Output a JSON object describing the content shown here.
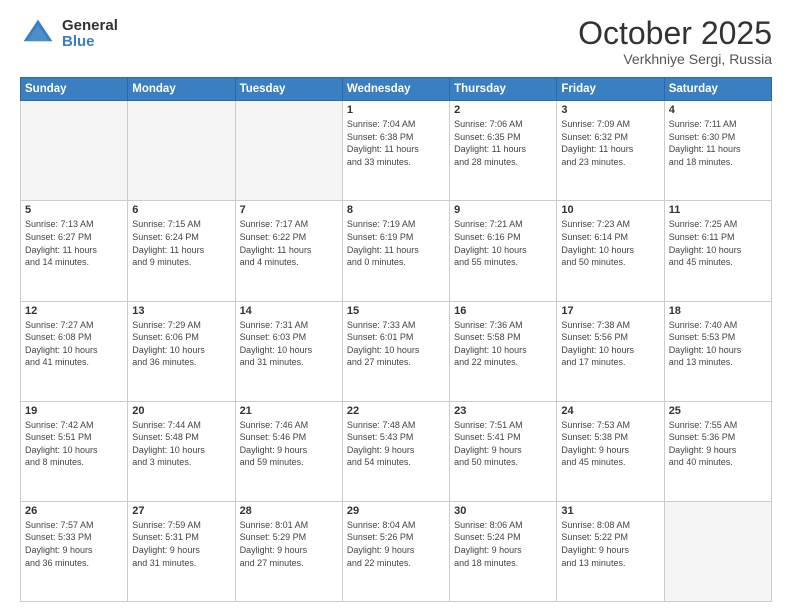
{
  "header": {
    "logo_general": "General",
    "logo_blue": "Blue",
    "month": "October 2025",
    "location": "Verkhniye Sergi, Russia"
  },
  "weekdays": [
    "Sunday",
    "Monday",
    "Tuesday",
    "Wednesday",
    "Thursday",
    "Friday",
    "Saturday"
  ],
  "weeks": [
    [
      {
        "day": "",
        "info": ""
      },
      {
        "day": "",
        "info": ""
      },
      {
        "day": "",
        "info": ""
      },
      {
        "day": "1",
        "info": "Sunrise: 7:04 AM\nSunset: 6:38 PM\nDaylight: 11 hours\nand 33 minutes."
      },
      {
        "day": "2",
        "info": "Sunrise: 7:06 AM\nSunset: 6:35 PM\nDaylight: 11 hours\nand 28 minutes."
      },
      {
        "day": "3",
        "info": "Sunrise: 7:09 AM\nSunset: 6:32 PM\nDaylight: 11 hours\nand 23 minutes."
      },
      {
        "day": "4",
        "info": "Sunrise: 7:11 AM\nSunset: 6:30 PM\nDaylight: 11 hours\nand 18 minutes."
      }
    ],
    [
      {
        "day": "5",
        "info": "Sunrise: 7:13 AM\nSunset: 6:27 PM\nDaylight: 11 hours\nand 14 minutes."
      },
      {
        "day": "6",
        "info": "Sunrise: 7:15 AM\nSunset: 6:24 PM\nDaylight: 11 hours\nand 9 minutes."
      },
      {
        "day": "7",
        "info": "Sunrise: 7:17 AM\nSunset: 6:22 PM\nDaylight: 11 hours\nand 4 minutes."
      },
      {
        "day": "8",
        "info": "Sunrise: 7:19 AM\nSunset: 6:19 PM\nDaylight: 11 hours\nand 0 minutes."
      },
      {
        "day": "9",
        "info": "Sunrise: 7:21 AM\nSunset: 6:16 PM\nDaylight: 10 hours\nand 55 minutes."
      },
      {
        "day": "10",
        "info": "Sunrise: 7:23 AM\nSunset: 6:14 PM\nDaylight: 10 hours\nand 50 minutes."
      },
      {
        "day": "11",
        "info": "Sunrise: 7:25 AM\nSunset: 6:11 PM\nDaylight: 10 hours\nand 45 minutes."
      }
    ],
    [
      {
        "day": "12",
        "info": "Sunrise: 7:27 AM\nSunset: 6:08 PM\nDaylight: 10 hours\nand 41 minutes."
      },
      {
        "day": "13",
        "info": "Sunrise: 7:29 AM\nSunset: 6:06 PM\nDaylight: 10 hours\nand 36 minutes."
      },
      {
        "day": "14",
        "info": "Sunrise: 7:31 AM\nSunset: 6:03 PM\nDaylight: 10 hours\nand 31 minutes."
      },
      {
        "day": "15",
        "info": "Sunrise: 7:33 AM\nSunset: 6:01 PM\nDaylight: 10 hours\nand 27 minutes."
      },
      {
        "day": "16",
        "info": "Sunrise: 7:36 AM\nSunset: 5:58 PM\nDaylight: 10 hours\nand 22 minutes."
      },
      {
        "day": "17",
        "info": "Sunrise: 7:38 AM\nSunset: 5:56 PM\nDaylight: 10 hours\nand 17 minutes."
      },
      {
        "day": "18",
        "info": "Sunrise: 7:40 AM\nSunset: 5:53 PM\nDaylight: 10 hours\nand 13 minutes."
      }
    ],
    [
      {
        "day": "19",
        "info": "Sunrise: 7:42 AM\nSunset: 5:51 PM\nDaylight: 10 hours\nand 8 minutes."
      },
      {
        "day": "20",
        "info": "Sunrise: 7:44 AM\nSunset: 5:48 PM\nDaylight: 10 hours\nand 3 minutes."
      },
      {
        "day": "21",
        "info": "Sunrise: 7:46 AM\nSunset: 5:46 PM\nDaylight: 9 hours\nand 59 minutes."
      },
      {
        "day": "22",
        "info": "Sunrise: 7:48 AM\nSunset: 5:43 PM\nDaylight: 9 hours\nand 54 minutes."
      },
      {
        "day": "23",
        "info": "Sunrise: 7:51 AM\nSunset: 5:41 PM\nDaylight: 9 hours\nand 50 minutes."
      },
      {
        "day": "24",
        "info": "Sunrise: 7:53 AM\nSunset: 5:38 PM\nDaylight: 9 hours\nand 45 minutes."
      },
      {
        "day": "25",
        "info": "Sunrise: 7:55 AM\nSunset: 5:36 PM\nDaylight: 9 hours\nand 40 minutes."
      }
    ],
    [
      {
        "day": "26",
        "info": "Sunrise: 7:57 AM\nSunset: 5:33 PM\nDaylight: 9 hours\nand 36 minutes."
      },
      {
        "day": "27",
        "info": "Sunrise: 7:59 AM\nSunset: 5:31 PM\nDaylight: 9 hours\nand 31 minutes."
      },
      {
        "day": "28",
        "info": "Sunrise: 8:01 AM\nSunset: 5:29 PM\nDaylight: 9 hours\nand 27 minutes."
      },
      {
        "day": "29",
        "info": "Sunrise: 8:04 AM\nSunset: 5:26 PM\nDaylight: 9 hours\nand 22 minutes."
      },
      {
        "day": "30",
        "info": "Sunrise: 8:06 AM\nSunset: 5:24 PM\nDaylight: 9 hours\nand 18 minutes."
      },
      {
        "day": "31",
        "info": "Sunrise: 8:08 AM\nSunset: 5:22 PM\nDaylight: 9 hours\nand 13 minutes."
      },
      {
        "day": "",
        "info": ""
      }
    ]
  ]
}
